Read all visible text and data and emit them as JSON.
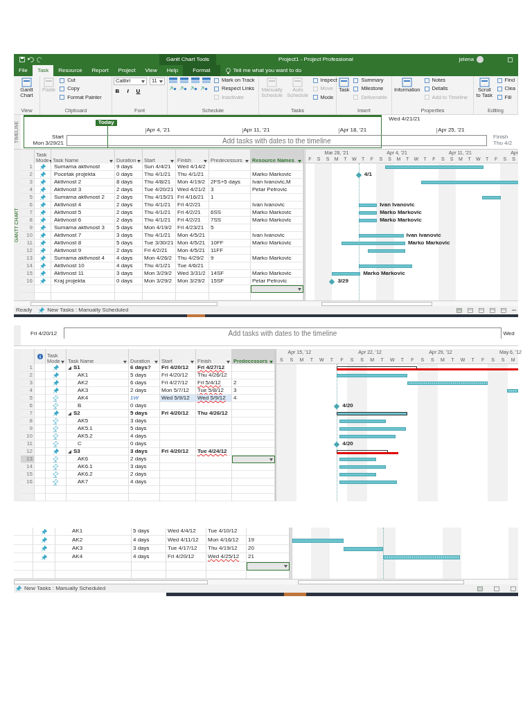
{
  "project_window": {
    "title_bar": {
      "context_group": "Gantt Chart Tools",
      "title": "Project1 - Project Professional",
      "user": "jelena"
    },
    "tabs": [
      {
        "label": "File",
        "selected": false
      },
      {
        "label": "Task",
        "selected": true
      },
      {
        "label": "Resource",
        "selected": false
      },
      {
        "label": "Report",
        "selected": false
      },
      {
        "label": "Project",
        "selected": false
      },
      {
        "label": "View",
        "selected": false
      },
      {
        "label": "Help",
        "selected": false
      },
      {
        "label": "Format",
        "selected": false,
        "kind": "context"
      }
    ],
    "tell_me": "Tell me what you want to do",
    "ribbon": [
      {
        "label": "View",
        "items": [
          {
            "kind": "large",
            "label": "Gantt Chart",
            "disabled": false
          }
        ]
      },
      {
        "label": "Clipboard",
        "items": [
          {
            "kind": "large",
            "label": "Paste",
            "disabled": true
          },
          {
            "kind": "small",
            "label": "Cut",
            "disabled": false
          },
          {
            "kind": "small",
            "label": "Copy",
            "disabled": false
          },
          {
            "kind": "small",
            "label": "Format Painter",
            "disabled": false
          }
        ]
      },
      {
        "label": "Font",
        "items": [
          {
            "kind": "combo",
            "label": "Calibri",
            "disabled": false
          },
          {
            "kind": "combo",
            "label": "11",
            "disabled": false
          },
          {
            "kind": "format",
            "label": "B",
            "disabled": false
          },
          {
            "kind": "format",
            "label": "I",
            "disabled": false
          },
          {
            "kind": "format",
            "label": "U",
            "disabled": false
          }
        ]
      },
      {
        "label": "Schedule",
        "items": [
          {
            "kind": "percent_buttons",
            "disabled": false
          },
          {
            "kind": "small",
            "label": "Mark on Track",
            "disabled": false
          },
          {
            "kind": "small",
            "label": "Respect Links",
            "disabled": false
          },
          {
            "kind": "small",
            "label": "Inactivate",
            "disabled": true
          }
        ]
      },
      {
        "label": "Tasks",
        "items": [
          {
            "kind": "large",
            "label": "Manually Schedule",
            "disabled": true
          },
          {
            "kind": "large",
            "label": "Auto Schedule",
            "disabled": true
          },
          {
            "kind": "small",
            "label": "Inspect",
            "disabled": false
          },
          {
            "kind": "small",
            "label": "Move",
            "disabled": true
          },
          {
            "kind": "small",
            "label": "Mode",
            "disabled": false
          }
        ]
      },
      {
        "label": "Insert",
        "items": [
          {
            "kind": "large",
            "label": "Task",
            "disabled": false
          },
          {
            "kind": "small",
            "label": "Summary",
            "disabled": false
          },
          {
            "kind": "small",
            "label": "Milestone",
            "disabled": false
          },
          {
            "kind": "small",
            "label": "Deliverable",
            "disabled": true
          }
        ]
      },
      {
        "label": "Properties",
        "items": [
          {
            "kind": "large",
            "label": "Information",
            "disabled": false
          },
          {
            "kind": "small",
            "label": "Notes",
            "disabled": false
          },
          {
            "kind": "small",
            "label": "Details",
            "disabled": false
          },
          {
            "kind": "small",
            "label": "Add to Timeline",
            "disabled": true
          }
        ]
      },
      {
        "label": "Editing",
        "items": [
          {
            "kind": "large",
            "label": "Scroll to Task",
            "disabled": false
          },
          {
            "kind": "small",
            "label": "Find",
            "disabled": false
          },
          {
            "kind": "small",
            "label": "Clea",
            "disabled": false
          },
          {
            "kind": "small",
            "label": "Fill",
            "disabled": false
          }
        ]
      }
    ],
    "timeline": {
      "side_label": "TIMELINE",
      "today": "Today",
      "view_end_date": "Wed 4/21/21",
      "dates": [
        "Apr 4, '21",
        "Apr 11, '21",
        "Apr 18, '21",
        "Apr 25, '21"
      ],
      "start_label": "Start",
      "start_date": "Mon 3/29/21",
      "prompt": "Add tasks with dates to the timeline",
      "finish_label": "Finish",
      "finish_date": "Thu 4/2"
    },
    "side_label": "GANTT CHART",
    "columns": [
      {
        "label": "Task Mode",
        "highlighted": false
      },
      {
        "label": "Task Name",
        "highlighted": false
      },
      {
        "label": "Duration",
        "highlighted": false
      },
      {
        "label": "Start",
        "highlighted": false
      },
      {
        "label": "Finish",
        "highlighted": false
      },
      {
        "label": "Predecessors",
        "highlighted": false
      },
      {
        "label": "Resource Names",
        "highlighted": true
      }
    ],
    "gantt_weeks": [
      "Mar 28, '21",
      "Apr 4, '21",
      "Apr 11, '21",
      "Apr"
    ],
    "gantt_days": [
      "F",
      "S",
      "S",
      "M",
      "T",
      "W",
      "T",
      "F",
      "S",
      "S",
      "M",
      "T",
      "W",
      "T",
      "F",
      "S",
      "S",
      "M",
      "T",
      "W",
      "T",
      "F",
      "S",
      "S"
    ],
    "rows": [
      {
        "id": "1",
        "kind": "manual",
        "name": "Sumarna aktivnost",
        "duration": "9 days",
        "start": "Sun 4/4/21",
        "finish": "Wed 4/14/2"
      },
      {
        "id": "2",
        "kind": "manual",
        "name": "Pocetak projekta",
        "duration": "0 days",
        "start": "Thu 4/1/21",
        "finish": "Thu 4/1/21",
        "resource": "Marko Markovic",
        "bar_label": "4/1"
      },
      {
        "id": "3",
        "kind": "manual",
        "name": "Aktivnost 2",
        "duration": "8 days",
        "start": "Thu 4/8/21",
        "finish": "Mon 4/19/2",
        "predecessors": "2FS+5 days",
        "resource": "Ivan Ivanovic,M"
      },
      {
        "id": "4",
        "kind": "manual",
        "name": "Aktivnost 3",
        "duration": "2 days",
        "start": "Tue 4/20/21",
        "finish": "Wed 4/21/2",
        "predecessors": "3",
        "resource": "Petar Petrovic"
      },
      {
        "id": "5",
        "kind": "manual",
        "name": "Sumarna aktivnost 2",
        "duration": "2 days",
        "start": "Thu 4/15/21",
        "finish": "Fri 4/16/21",
        "predecessors": "1"
      },
      {
        "id": "6",
        "kind": "manual",
        "name": "Aktivnost 4",
        "duration": "2 days",
        "start": "Thu 4/1/21",
        "finish": "Fri 4/2/21",
        "resource": "Ivan Ivanovic",
        "bar_label": "Ivan Ivanovic"
      },
      {
        "id": "7",
        "kind": "manual",
        "name": "Aktivnost 5",
        "duration": "2 days",
        "start": "Thu 4/1/21",
        "finish": "Fri 4/2/21",
        "predecessors": "6SS",
        "resource": "Marko Markovic",
        "bar_label": "Marko Markovic"
      },
      {
        "id": "8",
        "kind": "manual",
        "name": "Aktivnost 6",
        "duration": "2 days",
        "start": "Thu 4/1/21",
        "finish": "Fri 4/2/21",
        "predecessors": "7SS",
        "resource": "Marko Markovic",
        "bar_label": "Marko Markovic"
      },
      {
        "id": "9",
        "kind": "manual",
        "name": "Sumarna aktivnost 3",
        "duration": "5 days",
        "start": "Mon 4/19/2",
        "finish": "Fri 4/23/21",
        "predecessors": "5"
      },
      {
        "id": "10",
        "kind": "manual",
        "name": "Aktivnost 7",
        "duration": "3 days",
        "start": "Thu 4/1/21",
        "finish": "Mon 4/5/21",
        "resource": "Ivan Ivanovic",
        "bar_label": "Ivan Ivanovic"
      },
      {
        "id": "11",
        "kind": "manual",
        "name": "Aktivnost 8",
        "duration": "5 days",
        "start": "Tue 3/30/21",
        "finish": "Mon 4/5/21",
        "predecessors": "10FF",
        "resource": "Marko Markovic",
        "bar_label": "Marko Markovic"
      },
      {
        "id": "12",
        "kind": "manual",
        "name": "Aktivnost 9",
        "duration": "2 days",
        "start": "Fri 4/2/21",
        "finish": "Mon 4/5/21",
        "predecessors": "11FF"
      },
      {
        "id": "13",
        "kind": "manual",
        "name": "Sumarna aktivnost 4",
        "duration": "4 days",
        "start": "Mon 4/26/2",
        "finish": "Thu 4/29/2",
        "predecessors": "9",
        "resource": "Marko Markovic"
      },
      {
        "id": "14",
        "kind": "manual",
        "name": "Aktivnost 10",
        "duration": "4 days",
        "start": "Thu 4/1/21",
        "finish": "Tue 4/6/21"
      },
      {
        "id": "15",
        "kind": "manual",
        "name": "Aktivnost 11",
        "duration": "3 days",
        "start": "Mon 3/29/2",
        "finish": "Wed 3/31/2",
        "predecessors": "14SF",
        "resource": "Marko Markovic",
        "bar_label": "Marko Markovic"
      },
      {
        "id": "16",
        "kind": "manual",
        "name": "Kraj projekta",
        "duration": "0 days",
        "start": "Mon 3/29/2",
        "finish": "Mon 3/29/2",
        "predecessors": "15SF",
        "resource": "Petar Petrovic",
        "bar_label": "3/29"
      }
    ],
    "status": {
      "mode": "Ready",
      "new_tasks": "New Tasks : Manually Scheduled"
    }
  },
  "second_view": {
    "timeline": {
      "start_date": "Fri 4/20/12",
      "prompt": "Add tasks with dates to the timeline",
      "finish_date": "Wed"
    },
    "columns": [
      {
        "label": "Task Mode",
        "highlighted": false
      },
      {
        "label": "Task Name",
        "highlighted": false
      },
      {
        "label": "Duration",
        "highlighted": false
      },
      {
        "label": "Start",
        "highlighted": false
      },
      {
        "label": "Finish",
        "highlighted": false
      },
      {
        "label": "Predecessors",
        "highlighted": true
      }
    ],
    "gantt_weeks": [
      "Apr 15, '12",
      "Apr 22, '12",
      "Apr 29, '12",
      "May 6, '12"
    ],
    "gantt_days": [
      "S",
      "S",
      "M",
      "T",
      "W",
      "T",
      "F",
      "S",
      "S",
      "M",
      "T",
      "W",
      "T",
      "F",
      "S",
      "S",
      "M",
      "T",
      "W",
      "T",
      "F",
      "S",
      "S",
      "M"
    ],
    "tasks": [
      {
        "id": "1",
        "kind": "manual",
        "name": "S1",
        "duration": "6 days?",
        "start": "Fri 4/20/12",
        "finish": "Fri 4/27/12",
        "finish_flagged": true,
        "changed": false,
        "selected": false,
        "expanded": true,
        "children": [
          {
            "id": "2",
            "kind": "manual",
            "name": "AK1",
            "duration": "5 days",
            "start": "Fri 4/20/12",
            "finish": "Thu 4/26/12",
            "finish_flagged": false,
            "changed": false,
            "selected": false
          },
          {
            "id": "3",
            "kind": "manual",
            "name": "AK2",
            "duration": "6 days",
            "start": "Fri 4/27/12",
            "finish": "Fri 5/4/12",
            "predecessors": "2",
            "finish_flagged": true,
            "changed": false,
            "selected": false
          },
          {
            "id": "4",
            "kind": "manual",
            "name": "AK3",
            "duration": "2 days",
            "start": "Mon 5/7/12",
            "finish": "Tue 5/8/12",
            "predecessors": "3",
            "finish_flagged": true,
            "changed": false,
            "selected": false
          },
          {
            "id": "5",
            "kind": "auto",
            "name": "AK4",
            "duration": "1W",
            "start": "Wed 5/9/12",
            "finish": "Wed 5/9/12",
            "predecessors": "4",
            "finish_flagged": true,
            "changed": true,
            "selected": false
          },
          {
            "id": "6",
            "kind": "auto",
            "name": "B",
            "duration": "0 days",
            "changed": false,
            "selected": false,
            "bar_label": "4/20"
          }
        ]
      },
      {
        "id": "7",
        "kind": "manual",
        "name": "S2",
        "duration": "5 days",
        "start": "Fri 4/20/12",
        "finish": "Thu 4/26/12",
        "finish_flagged": false,
        "changed": false,
        "selected": false,
        "expanded": true,
        "children": [
          {
            "id": "8",
            "kind": "auto",
            "name": "AK5",
            "duration": "3 days",
            "changed": false,
            "selected": false
          },
          {
            "id": "9",
            "kind": "auto",
            "name": "AK5.1",
            "duration": "5 days",
            "changed": false,
            "selected": false
          },
          {
            "id": "10",
            "kind": "auto",
            "name": "AK5.2",
            "duration": "4 days",
            "changed": false,
            "selected": false
          },
          {
            "id": "11",
            "kind": "auto",
            "name": "C",
            "duration": "0 days",
            "changed": false,
            "selected": false,
            "bar_label": "4/20"
          }
        ]
      },
      {
        "id": "12",
        "kind": "manual",
        "name": "S3",
        "duration": "3 days",
        "start": "Fri 4/20/12",
        "finish": "Tue 4/24/12",
        "finish_flagged": true,
        "changed": false,
        "selected": false,
        "expanded": true,
        "children": [
          {
            "id": "13",
            "kind": "auto",
            "name": "AK6",
            "duration": "2 days",
            "changed": false,
            "selected": true
          },
          {
            "id": "14",
            "kind": "auto",
            "name": "AK6.1",
            "duration": "3 days",
            "changed": false,
            "selected": false
          },
          {
            "id": "15",
            "kind": "auto",
            "name": "AK6.2",
            "duration": "2 days",
            "changed": false,
            "selected": false
          },
          {
            "id": "16",
            "kind": "auto",
            "name": "AK7",
            "duration": "4 days",
            "changed": false,
            "selected": false
          }
        ]
      }
    ]
  },
  "third_view": {
    "rows": [
      {
        "kind": "manual",
        "name": "AK1",
        "duration": "5 days",
        "start": "Wed 4/4/12",
        "finish": "Tue 4/10/12",
        "finish_flagged": false
      },
      {
        "kind": "manual",
        "name": "AK2",
        "duration": "4 days",
        "start": "Wed 4/11/12",
        "finish": "Mon 4/16/12",
        "predecessors": "19",
        "finish_flagged": false
      },
      {
        "kind": "manual",
        "name": "AK3",
        "duration": "3 days",
        "start": "Tue 4/17/12",
        "finish": "Thu 4/19/12",
        "predecessors": "20",
        "finish_flagged": false
      },
      {
        "kind": "manual",
        "name": "AK4",
        "duration": "4 days",
        "start": "Fri 4/20/12",
        "finish": "Wed 4/25/12",
        "predecessors": "21",
        "finish_flagged": true
      }
    ],
    "status": {
      "new_tasks": "New Tasks : Manually Scheduled"
    }
  }
}
